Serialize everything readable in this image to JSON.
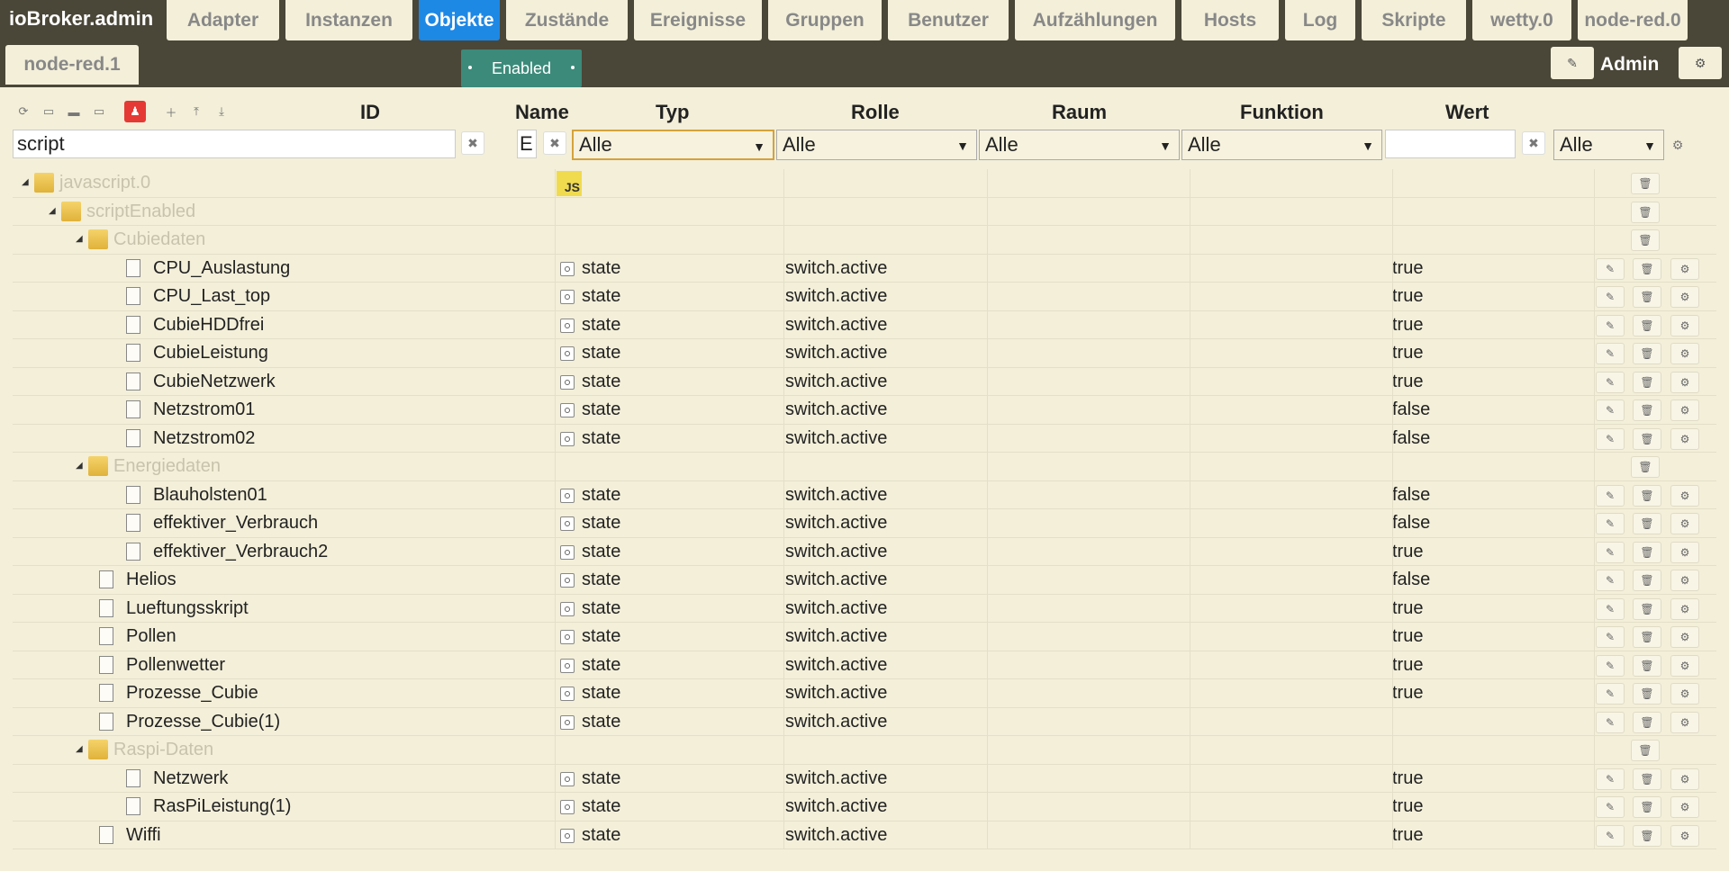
{
  "app": {
    "brand": "ioBroker.admin",
    "user": "Admin"
  },
  "tabs": [
    "Adapter",
    "Instanzen",
    "Objekte",
    "Zustände",
    "Ereignisse",
    "Gruppen",
    "Benutzer",
    "Aufzählungen",
    "Hosts",
    "Log",
    "Skripte",
    "wetty.0",
    "node-red.0"
  ],
  "active_tab": "Objekte",
  "second_tab": "node-red.1",
  "toggle_label": "Enabled",
  "columns": {
    "id": "ID",
    "name": "Name",
    "type": "Typ",
    "role": "Rolle",
    "room": "Raum",
    "function": "Funktion",
    "value": "Wert"
  },
  "filters": {
    "id_value": "script",
    "name_value": "E",
    "type_select": "Alle",
    "role_select": "Alle",
    "room_select": "Alle",
    "function_select": "Alle",
    "value_value": "",
    "extra_select": "Alle"
  },
  "rows": [
    {
      "kind": "folder",
      "name": "javascript.0",
      "level": 0,
      "js": "JS"
    },
    {
      "kind": "folder",
      "name": "scriptEnabled",
      "level": 1
    },
    {
      "kind": "folder",
      "name": "Cubiedaten",
      "level": 2
    },
    {
      "kind": "state",
      "name": "CPU_Auslastung",
      "level": 3,
      "type": "state",
      "role": "switch.active",
      "value": "true"
    },
    {
      "kind": "state",
      "name": "CPU_Last_top",
      "level": 3,
      "type": "state",
      "role": "switch.active",
      "value": "true"
    },
    {
      "kind": "state",
      "name": "CubieHDDfrei",
      "level": 3,
      "type": "state",
      "role": "switch.active",
      "value": "true"
    },
    {
      "kind": "state",
      "name": "CubieLeistung",
      "level": 3,
      "type": "state",
      "role": "switch.active",
      "value": "true"
    },
    {
      "kind": "state",
      "name": "CubieNetzwerk",
      "level": 3,
      "type": "state",
      "role": "switch.active",
      "value": "true"
    },
    {
      "kind": "state",
      "name": "Netzstrom01",
      "level": 3,
      "type": "state",
      "role": "switch.active",
      "value": "false"
    },
    {
      "kind": "state",
      "name": "Netzstrom02",
      "level": 3,
      "type": "state",
      "role": "switch.active",
      "value": "false"
    },
    {
      "kind": "folder",
      "name": "Energiedaten",
      "level": 2
    },
    {
      "kind": "state",
      "name": "Blauholsten01",
      "level": 3,
      "type": "state",
      "role": "switch.active",
      "value": "false"
    },
    {
      "kind": "state",
      "name": "effektiver_Verbrauch",
      "level": 3,
      "type": "state",
      "role": "switch.active",
      "value": "false"
    },
    {
      "kind": "state",
      "name": "effektiver_Verbrauch2",
      "level": 3,
      "type": "state",
      "role": "switch.active",
      "value": "true"
    },
    {
      "kind": "state",
      "name": "Helios",
      "level": 2,
      "type": "state",
      "role": "switch.active",
      "value": "false"
    },
    {
      "kind": "state",
      "name": "Lueftungsskript",
      "level": 2,
      "type": "state",
      "role": "switch.active",
      "value": "true"
    },
    {
      "kind": "state",
      "name": "Pollen",
      "level": 2,
      "type": "state",
      "role": "switch.active",
      "value": "true"
    },
    {
      "kind": "state",
      "name": "Pollenwetter",
      "level": 2,
      "type": "state",
      "role": "switch.active",
      "value": "true"
    },
    {
      "kind": "state",
      "name": "Prozesse_Cubie",
      "level": 2,
      "type": "state",
      "role": "switch.active",
      "value": "true"
    },
    {
      "kind": "state",
      "name": "Prozesse_Cubie(1)",
      "level": 2,
      "type": "state",
      "role": "switch.active",
      "value": ""
    },
    {
      "kind": "folder",
      "name": "Raspi-Daten",
      "level": 2
    },
    {
      "kind": "state",
      "name": "Netzwerk",
      "level": 3,
      "type": "state",
      "role": "switch.active",
      "value": "true"
    },
    {
      "kind": "state",
      "name": "RasPiLeistung(1)",
      "level": 3,
      "type": "state",
      "role": "switch.active",
      "value": "true"
    },
    {
      "kind": "state",
      "name": "Wiffi",
      "level": 2,
      "type": "state",
      "role": "switch.active",
      "value": "true"
    }
  ],
  "icons": {
    "edit": "pencil-icon",
    "delete": "trash-icon",
    "settings": "gear-icon",
    "refresh": "refresh-icon",
    "collapse": "collapse-icon",
    "folder_open": "folder-open-icon",
    "folder": "folder-icon",
    "user": "user-icon",
    "add": "plus-icon",
    "upload": "upload-icon",
    "download": "download-icon"
  },
  "colors": {
    "active_tab": "#1e88e5",
    "toggle": "#3c8a7a",
    "bar": "#4a4638",
    "js_badge": "#f0db4f"
  }
}
